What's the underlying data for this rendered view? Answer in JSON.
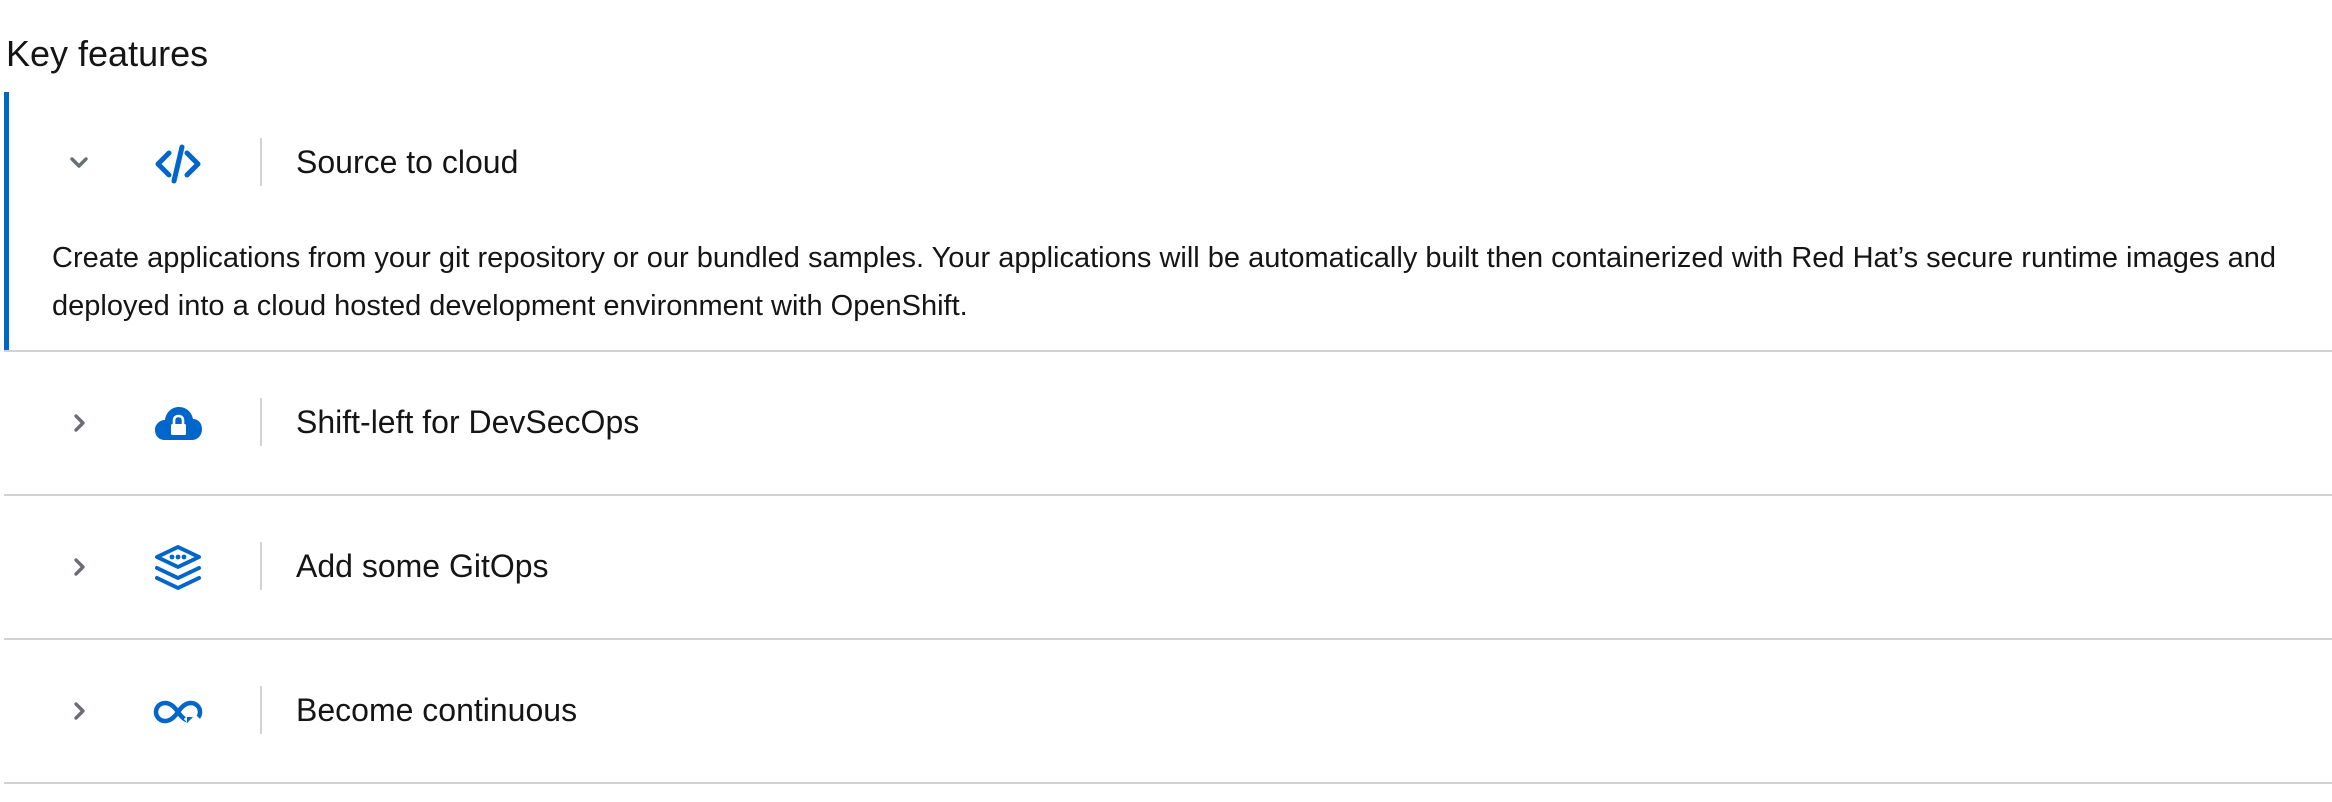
{
  "page": {
    "title": "Key features"
  },
  "accordion": {
    "items": [
      {
        "label": "Source to cloud",
        "icon": "code-icon",
        "expanded": true,
        "body": "Create applications from your git repository or our bundled samples. Your applications will be automatically built then containerized with Red Hat’s secure runtime images and deployed into a cloud hosted development environment with OpenShift."
      },
      {
        "label": "Shift-left for DevSecOps",
        "icon": "cloud-lock-icon",
        "expanded": false
      },
      {
        "label": "Add some GitOps",
        "icon": "layers-icon",
        "expanded": false
      },
      {
        "label": "Become continuous",
        "icon": "infinity-icon",
        "expanded": false
      }
    ]
  },
  "colors": {
    "accent": "#0066cc",
    "text": "#151515",
    "chevron": "#6a6e73",
    "border": "#d2d2d2"
  }
}
